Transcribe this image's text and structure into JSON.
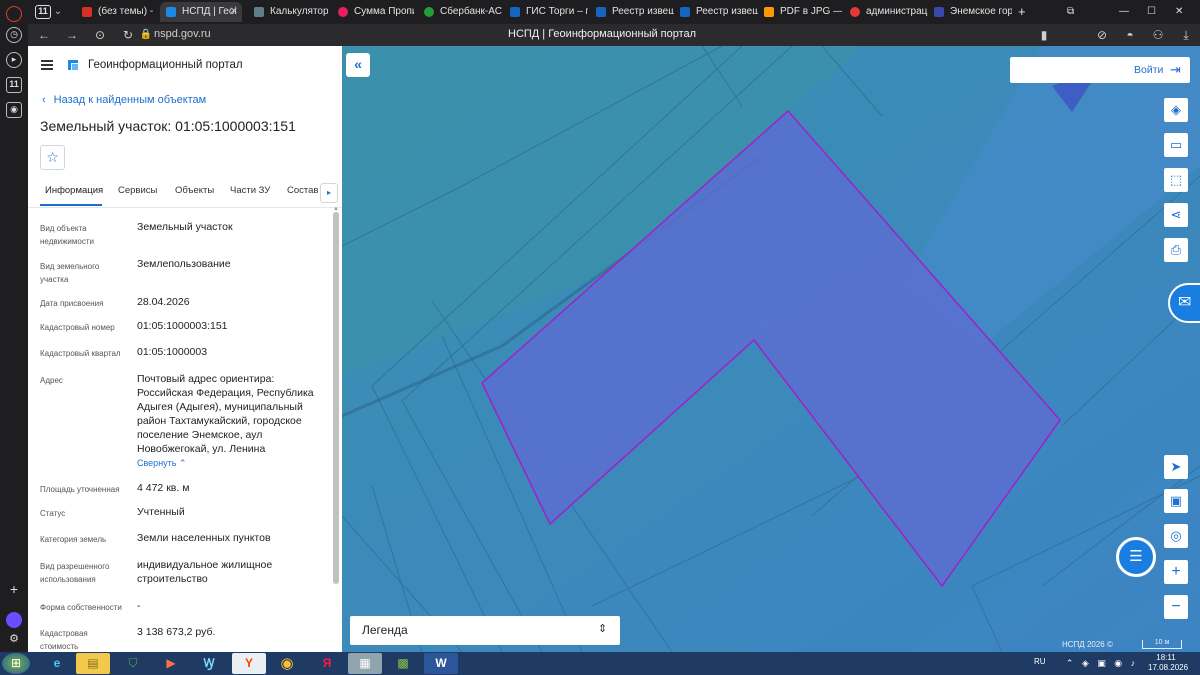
{
  "browser": {
    "tab_count": "11",
    "tabs": [
      {
        "label": "(без темы) - rai",
        "color": "#d93025"
      },
      {
        "label": "НСПД | Геоі",
        "color": "#1e88e5"
      },
      {
        "label": "Калькулятор д",
        "color": "#607d8b"
      },
      {
        "label": "Сумма Пропис",
        "color": "#e91e63"
      },
      {
        "label": "Сбербанк-АСТ",
        "color": "#21a038"
      },
      {
        "label": "ГИС Торги – пр",
        "color": "#1565c0"
      },
      {
        "label": "Реестр извеще",
        "color": "#1565c0"
      },
      {
        "label": "Реестр извеще",
        "color": "#1565c0"
      },
      {
        "label": "PDF в JPG — К",
        "color": "#ff9800"
      },
      {
        "label": "администрац",
        "color": "#e53935"
      },
      {
        "label": "Энемское горо",
        "color": "#3949ab"
      }
    ],
    "url": "nspd.gov.ru",
    "page_title": "НСПД | Геоинформационный портал",
    "left_badge": "11"
  },
  "panel": {
    "portal_name": "Геоинформационный портал",
    "back_link": "Назад к найденным объектам",
    "title": "Земельный участок: 01:05:1000003:151",
    "tabs": [
      "Информация",
      "Сервисы",
      "Объекты",
      "Части ЗУ",
      "Состав"
    ],
    "fields": [
      {
        "label": "Вид объекта недвижимости",
        "value": "Земельный участок"
      },
      {
        "label": "Вид земельного участка",
        "value": "Землепользование"
      },
      {
        "label": "Дата присвоения",
        "value": "28.04.2026"
      },
      {
        "label": "Кадастровый номер",
        "value": "01:05:1000003:151"
      },
      {
        "label": "Кадастровый квартал",
        "value": "01:05:1000003"
      },
      {
        "label": "Адрес",
        "value": "Почтовый адрес ориентира: Российская Федерация, Республика Адыгея (Адыгея), муниципальный район Тахтамукайский, городское поселение Энемское, аул Новобжегокай, ул. Ленина"
      },
      {
        "label": "Площадь уточненная",
        "value": "4 472 кв. м"
      },
      {
        "label": "Статус",
        "value": "Учтенный"
      },
      {
        "label": "Категория земель",
        "value": "Земли населенных пунктов"
      },
      {
        "label": "Вид разрешенного использования",
        "value": "индивидуальное жилищное строительство"
      },
      {
        "label": "Форма собственности",
        "value": "-"
      },
      {
        "label": "Кадастровая стоимость",
        "value": "3 138 673,2 руб."
      }
    ],
    "collapse_link": "Свернуть"
  },
  "map": {
    "login_label": "Войти",
    "legend_label": "Легенда",
    "copyright": "НСПД 2026 ©",
    "scale_label": "10 м",
    "parcel_fill": "#5b6fd0",
    "parcel_stroke": "#a020c8"
  },
  "taskbar": {
    "lang": "RU",
    "time": "18:11",
    "date": "17.08.2026"
  }
}
